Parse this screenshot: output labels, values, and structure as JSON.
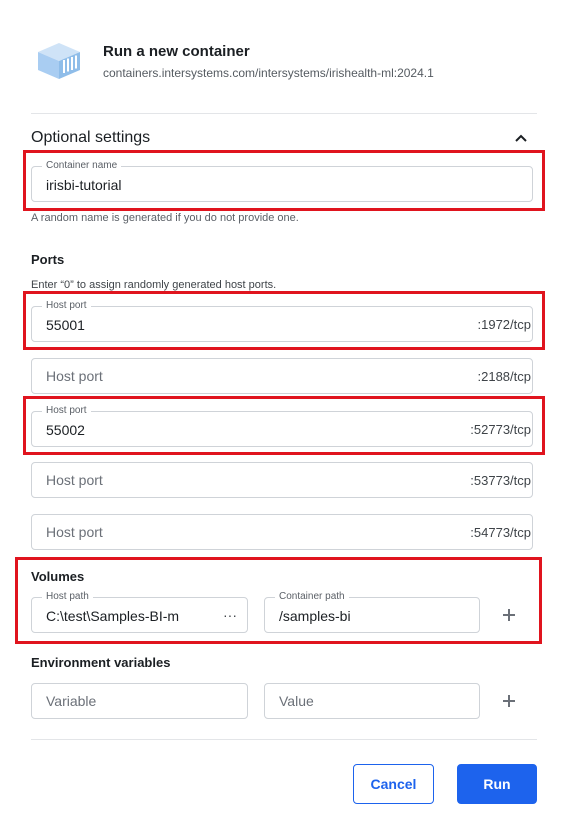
{
  "header": {
    "title": "Run a new container",
    "image": "containers.intersystems.com/intersystems/irishealth-ml:2024.1",
    "logo_icon": "docker-image-cube-icon"
  },
  "optional_settings": {
    "title": "Optional settings",
    "toggle_icon": "chevron-up-icon"
  },
  "container_name": {
    "label": "Container name",
    "value": "irisbi-tutorial",
    "helper": "A random name is generated if you do not provide one."
  },
  "ports": {
    "heading": "Ports",
    "helper": "Enter “0” to assign randomly generated host ports.",
    "items": [
      {
        "label": "Host port",
        "value": "55001",
        "placeholder": "",
        "container_port": ":1972/tcp"
      },
      {
        "label": "",
        "value": "",
        "placeholder": "Host port",
        "container_port": ":2188/tcp"
      },
      {
        "label": "Host port",
        "value": "55002",
        "placeholder": "",
        "container_port": ":52773/tcp"
      },
      {
        "label": "",
        "value": "",
        "placeholder": "Host port",
        "container_port": ":53773/tcp"
      },
      {
        "label": "",
        "value": "",
        "placeholder": "Host port",
        "container_port": ":54773/tcp"
      }
    ]
  },
  "volumes": {
    "heading": "Volumes",
    "host_path_label": "Host path",
    "host_path_value": "C:\\test\\Samples-BI-m",
    "browse_label": "···",
    "container_path_label": "Container path",
    "container_path_value": "/samples-bi"
  },
  "env": {
    "heading": "Environment variables",
    "variable_placeholder": "Variable",
    "value_placeholder": "Value"
  },
  "footer": {
    "cancel_label": "Cancel",
    "run_label": "Run"
  },
  "colors": {
    "primary": "#1d63ed",
    "highlight": "#e0141e",
    "logo": "#a9cdf2"
  }
}
